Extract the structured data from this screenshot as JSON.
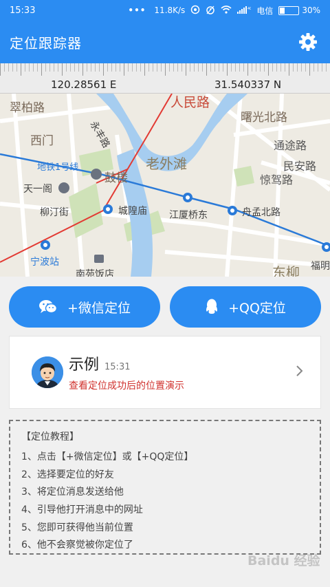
{
  "status_bar": {
    "time": "15:33",
    "dots": "•••",
    "speed": "11.8K/s",
    "carrier": "电信",
    "battery_text": "30%",
    "battery_level": 0.3
  },
  "app_bar": {
    "title": "定位跟踪器",
    "settings_icon": "gear-icon"
  },
  "coords": {
    "longitude": "120.28561 E",
    "latitude": "31.540337 N"
  },
  "map": {
    "labels": {
      "renminlu": "人民路",
      "cuibailu": "翠柏路",
      "ximen": "西门",
      "shuguangbeilu": "曙光北路",
      "tongtulu": "通途路",
      "minanlu": "民安路",
      "jingaolu": "惊驾路",
      "laowaitan": "老外滩",
      "metro1": "地铁1号线",
      "gulou": "鼓楼",
      "tianyige": "天一阁",
      "liutingjie": "柳汀街",
      "chenghuangmiao": "城隍庙",
      "jiangxiaqiaodong": "江厦桥东",
      "yumengbeilu": "舟孟北路",
      "ningbozhan": "宁波站",
      "nanyuanfandian": "南苑饭店",
      "dongliu": "东柳",
      "fuming": "福明",
      "yongfenglu": "永丰路"
    }
  },
  "actions": {
    "wechat_label": "+微信定位",
    "qq_label": "+QQ定位"
  },
  "sample": {
    "title": "示例",
    "time": "15:31",
    "subtitle": "查看定位成功后的位置演示"
  },
  "tutorial": {
    "heading": "【定位教程】",
    "steps": [
      "1、点击【+微信定位】或【+QQ定位】",
      "2、选择要定位的好友",
      "3、将定位消息发送给他",
      "4、引导他打开消息中的网址",
      "5、您即可获得他当前位置",
      "6、他不会察觉被你定位了"
    ]
  },
  "watermark": "Baidu 经验",
  "colors": {
    "primary": "#2b8cf2",
    "accent_red": "#d0312d",
    "background": "#f0f0f0"
  }
}
